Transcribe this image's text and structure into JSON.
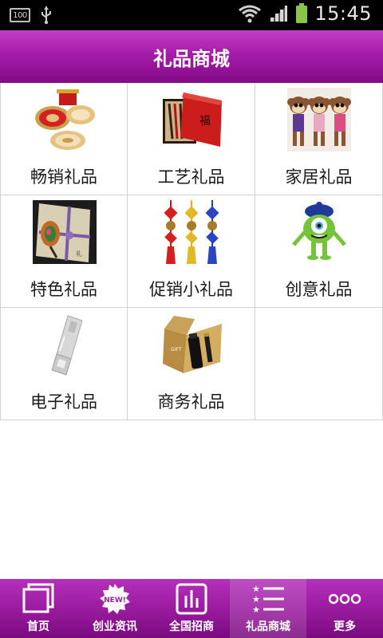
{
  "status_bar": {
    "battery_text": "100",
    "time": "15:45",
    "icons": [
      "battery-outline-icon",
      "usb-icon",
      "wifi-icon",
      "signal-icon",
      "battery-icon"
    ]
  },
  "header": {
    "title": "礼品商城"
  },
  "categories": [
    {
      "label": "畅销礼品",
      "icon": "coasters-image"
    },
    {
      "label": "工艺礼品",
      "icon": "chopsticks-box-image"
    },
    {
      "label": "家居礼品",
      "icon": "monkey-figurines-image"
    },
    {
      "label": "特色礼品",
      "icon": "gift-box-image"
    },
    {
      "label": "促销小礼品",
      "icon": "chinese-knots-image"
    },
    {
      "label": "创意礼品",
      "icon": "green-monster-image"
    },
    {
      "label": "电子礼品",
      "icon": "usb-drive-image"
    },
    {
      "label": "商务礼品",
      "icon": "business-gift-set-image"
    }
  ],
  "bottom_nav": {
    "items": [
      {
        "label": "首页",
        "icon": "home-icon",
        "active": false
      },
      {
        "label": "创业资讯",
        "icon": "new-badge-icon",
        "active": false
      },
      {
        "label": "全国招商",
        "icon": "bar-chart-icon",
        "active": false
      },
      {
        "label": "礼品商城",
        "icon": "star-list-icon",
        "active": true
      },
      {
        "label": "更多",
        "icon": "more-dots-icon",
        "active": false
      }
    ],
    "badge_text": "NEW!"
  },
  "colors": {
    "accent": "#a51ba9",
    "accent_dark": "#820b86",
    "grid_border": "#d2d2d2"
  }
}
